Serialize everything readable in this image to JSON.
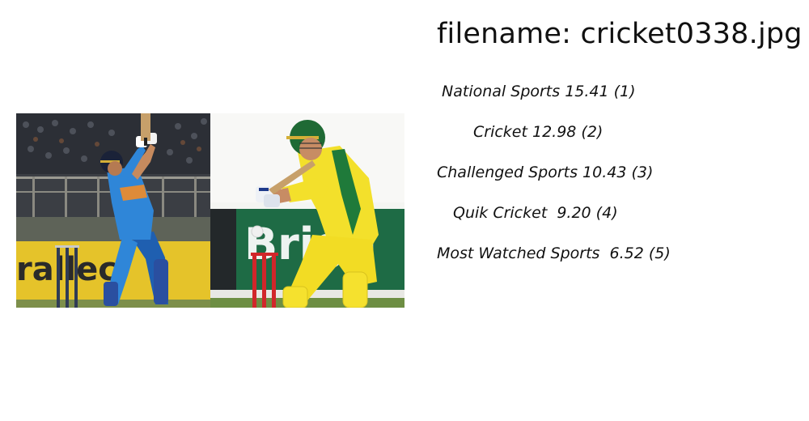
{
  "filename_text": "filename: cricket0338.jpg",
  "predictions": [
    {
      "text": " National Sports 15.41 (1)"
    },
    {
      "text": "Cricket 12.98 (2)"
    },
    {
      "text": "Challenged Sports 10.43 (3)"
    },
    {
      "text": "Quik Cricket  9.20 (4)"
    },
    {
      "text": "Most Watched Sports  6.52 (5)"
    }
  ],
  "image": {
    "left_panel_banner_text": "rallec",
    "right_panel_banner_text": "Brigh"
  },
  "colors": {
    "india_jersey": "#2f86d8",
    "australia_jersey": "#f3e02b",
    "australia_trim": "#1f7a3a",
    "banner_green": "#1e6b45",
    "banner_yellow": "#e5c32a"
  }
}
